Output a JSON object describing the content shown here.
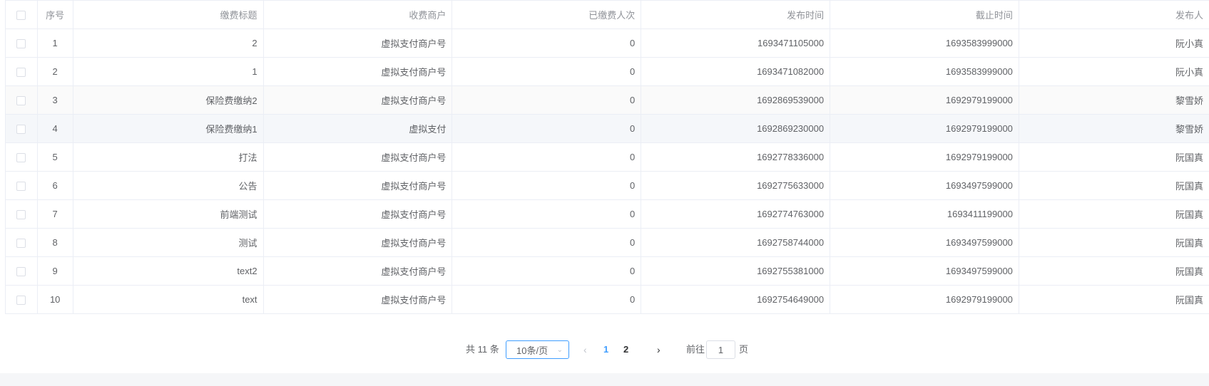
{
  "table": {
    "headers": {
      "seq": "序号",
      "title": "缴费标题",
      "merchant": "收费商户",
      "paid_count": "已缴费人次",
      "publish_time": "发布时间",
      "deadline": "截止时间",
      "publisher": "发布人"
    },
    "rows": [
      {
        "seq": "1",
        "title": "2",
        "merchant": "虚拟支付商户号",
        "paid_count": "0",
        "publish_time": "1693471105000",
        "deadline": "1693583999000",
        "publisher": "阮小真"
      },
      {
        "seq": "2",
        "title": "1",
        "merchant": "虚拟支付商户号",
        "paid_count": "0",
        "publish_time": "1693471082000",
        "deadline": "1693583999000",
        "publisher": "阮小真"
      },
      {
        "seq": "3",
        "title": "保险费缴纳2",
        "merchant": "虚拟支付商户号",
        "paid_count": "0",
        "publish_time": "1692869539000",
        "deadline": "1692979199000",
        "publisher": "黎雪娇"
      },
      {
        "seq": "4",
        "title": "保险费缴纳1",
        "merchant": "虚拟支付",
        "paid_count": "0",
        "publish_time": "1692869230000",
        "deadline": "1692979199000",
        "publisher": "黎雪娇"
      },
      {
        "seq": "5",
        "title": "打法",
        "merchant": "虚拟支付商户号",
        "paid_count": "0",
        "publish_time": "1692778336000",
        "deadline": "1692979199000",
        "publisher": "阮国真"
      },
      {
        "seq": "6",
        "title": "公告",
        "merchant": "虚拟支付商户号",
        "paid_count": "0",
        "publish_time": "1692775633000",
        "deadline": "1693497599000",
        "publisher": "阮国真"
      },
      {
        "seq": "7",
        "title": "前端测试",
        "merchant": "虚拟支付商户号",
        "paid_count": "0",
        "publish_time": "1692774763000",
        "deadline": "1693411199000",
        "publisher": "阮国真"
      },
      {
        "seq": "8",
        "title": "测试",
        "merchant": "虚拟支付商户号",
        "paid_count": "0",
        "publish_time": "1692758744000",
        "deadline": "1693497599000",
        "publisher": "阮国真"
      },
      {
        "seq": "9",
        "title": "text2",
        "merchant": "虚拟支付商户号",
        "paid_count": "0",
        "publish_time": "1692755381000",
        "deadline": "1693497599000",
        "publisher": "阮国真"
      },
      {
        "seq": "10",
        "title": "text",
        "merchant": "虚拟支付商户号",
        "paid_count": "0",
        "publish_time": "1692754649000",
        "deadline": "1692979199000",
        "publisher": "阮国真"
      }
    ]
  },
  "pagination": {
    "total_label": "共 11 条",
    "page_size_label": "10条/页",
    "prev_icon": "chevron-left-icon",
    "next_icon": "chevron-right-icon",
    "pages": [
      "1",
      "2"
    ],
    "current_page": "1",
    "goto_label": "前往",
    "goto_value": "1",
    "page_suffix": "页"
  },
  "colors": {
    "accent": "#409eff",
    "border": "#ebeef5",
    "header_text": "#909399",
    "cell_text": "#606266",
    "hover_row": "#f5f7fa"
  }
}
